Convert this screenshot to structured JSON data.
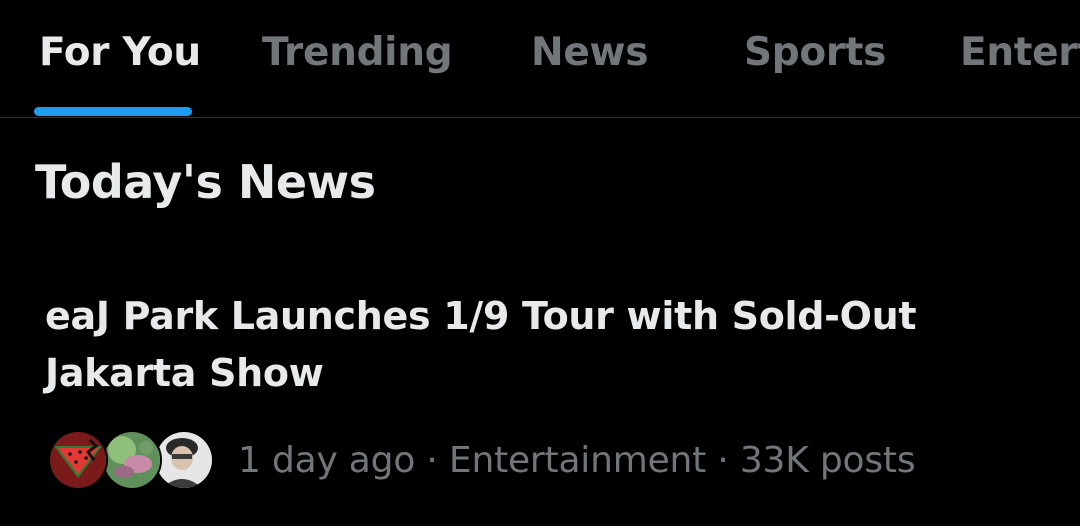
{
  "tabs": [
    {
      "label": "For You",
      "active": true
    },
    {
      "label": "Trending",
      "active": false
    },
    {
      "label": "News",
      "active": false
    },
    {
      "label": "Sports",
      "active": false
    },
    {
      "label": "Entert",
      "active": false
    }
  ],
  "section": {
    "title": "Today's News"
  },
  "news_item": {
    "headline": "eaJ Park Launches 1/9 Tour with Sold-Out Jakarta Show",
    "time": "1 day ago",
    "separator": "·",
    "category": "Entertainment",
    "posts": "33K posts",
    "avatars": [
      "watermelon-avatar",
      "green-pink-avatar",
      "person-photo-avatar"
    ]
  },
  "colors": {
    "background": "#000000",
    "text_primary": "#e7e9ea",
    "text_secondary": "#71767b",
    "accent": "#1d9bf0",
    "divider": "#2f3336"
  }
}
